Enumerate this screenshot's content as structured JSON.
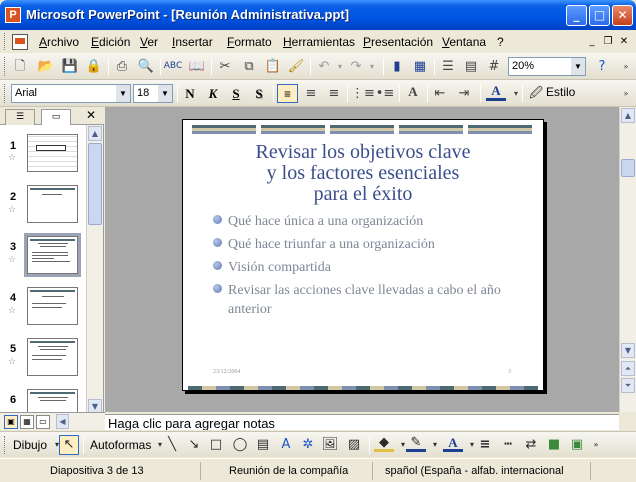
{
  "window": {
    "title": "Microsoft PowerPoint - [Reunión Administrativa.ppt]",
    "minimize": "_",
    "maximize": "□",
    "close": "✕"
  },
  "menu": {
    "items": [
      "Archivo",
      "Edición",
      "Ver",
      "Insertar",
      "Formato",
      "Herramientas",
      "Presentación",
      "Ventana",
      "?"
    ]
  },
  "standard_toolbar": {
    "zoom": "20%",
    "buttons": [
      "new-icon",
      "open-icon",
      "save-icon",
      "permission-icon",
      "print-icon",
      "print-preview-icon",
      "spelling-icon",
      "research-icon",
      "cut-icon",
      "copy-icon",
      "paste-icon",
      "format-painter-icon",
      "undo-icon",
      "redo-icon",
      "insert-chart-icon",
      "insert-table-icon",
      "expand-all-icon",
      "show-grid-icon",
      "help-icon"
    ]
  },
  "formatting_toolbar": {
    "font": "Arial",
    "size": "18",
    "bold": "N",
    "italic": "K",
    "underline": "S",
    "shadow": "S",
    "style_label": "Estilo"
  },
  "thumbnail_panel": {
    "slide_numbers": [
      "1",
      "2",
      "3",
      "4",
      "5",
      "6"
    ],
    "selected_index": 3
  },
  "slide": {
    "title_lines": [
      "Revisar los objetivos clave",
      "y los factores esenciales",
      "para el éxito"
    ],
    "bullets": [
      "Qué hace única a una organización",
      "Qué hace triunfar a una organización",
      "Visión compartida",
      "Revisar las acciones clave llevadas a cabo el año anterior"
    ],
    "date": "23/12/2004",
    "number": "3"
  },
  "notes_placeholder": "Haga clic para agregar notas",
  "drawing_toolbar": {
    "draw_label": "Dibujo",
    "autoshapes_label": "Autoformas"
  },
  "status": {
    "slide_info": "Diapositiva 3 de 13",
    "design": "Reunión de la compañía",
    "language": "spañol (España - alfab. internacional"
  }
}
